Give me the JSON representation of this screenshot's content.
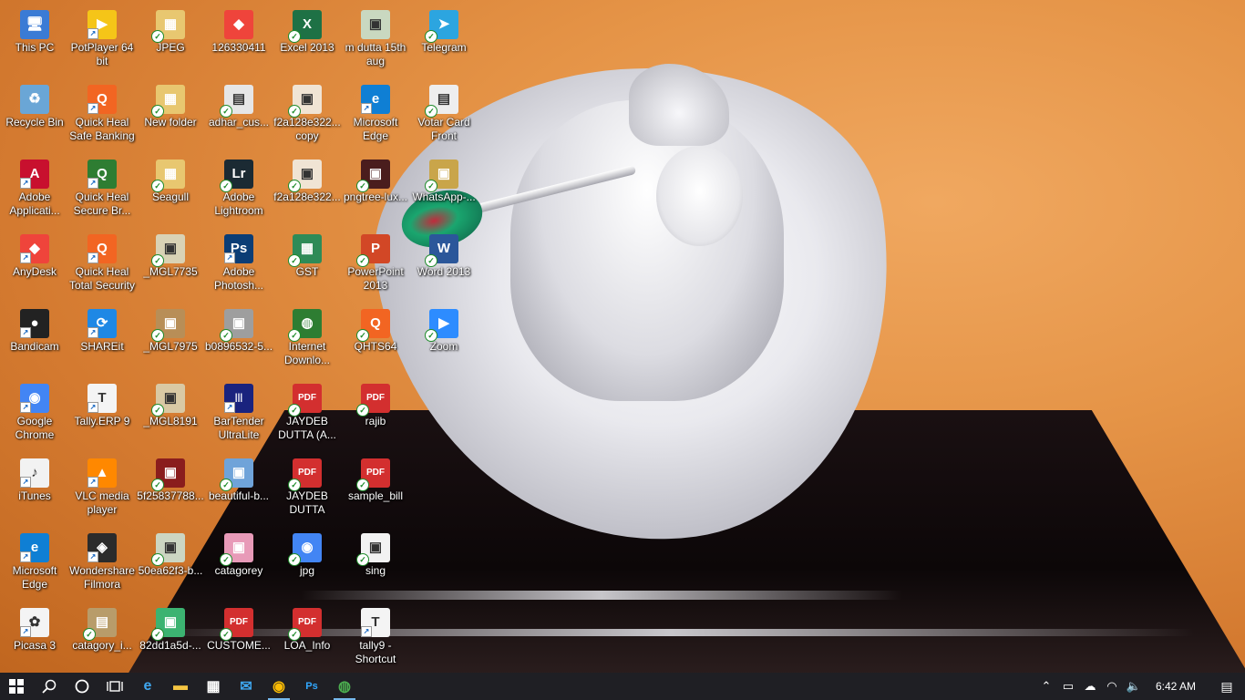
{
  "desktop": {
    "icons": [
      {
        "label": "This PC",
        "glyph": "🖥",
        "bg": "#3a7bd5",
        "badge": "none"
      },
      {
        "label": "Recycle Bin",
        "glyph": "♻",
        "bg": "#6aa6d6",
        "badge": "none"
      },
      {
        "label": "Adobe Applicati...",
        "glyph": "A",
        "bg": "#c8102e",
        "badge": "shortcut"
      },
      {
        "label": "AnyDesk",
        "glyph": "◆",
        "bg": "#ef443b",
        "badge": "shortcut"
      },
      {
        "label": "Bandicam",
        "glyph": "●",
        "bg": "#222222",
        "badge": "shortcut"
      },
      {
        "label": "Google Chrome",
        "glyph": "◉",
        "bg": "#4285f4",
        "badge": "shortcut"
      },
      {
        "label": "iTunes",
        "glyph": "♪",
        "bg": "#f2f2f2",
        "badge": "shortcut"
      },
      {
        "label": "Microsoft Edge",
        "glyph": "e",
        "bg": "#0f7fd4",
        "badge": "shortcut"
      },
      {
        "label": "Picasa 3",
        "glyph": "✿",
        "bg": "#f4f4f4",
        "badge": "shortcut"
      },
      {
        "label": "PotPlayer 64 bit",
        "glyph": "▶",
        "bg": "#f5c518",
        "badge": "shortcut"
      },
      {
        "label": "Quick Heal Safe Banking",
        "glyph": "Q",
        "bg": "#f26522",
        "badge": "shortcut"
      },
      {
        "label": "Quick Heal Secure Br...",
        "glyph": "Q",
        "bg": "#2e7d32",
        "badge": "shortcut"
      },
      {
        "label": "Quick Heal Total Security",
        "glyph": "Q",
        "bg": "#f26522",
        "badge": "shortcut"
      },
      {
        "label": "SHAREit",
        "glyph": "⟳",
        "bg": "#1e88e5",
        "badge": "shortcut"
      },
      {
        "label": "Tally.ERP 9",
        "glyph": "T",
        "bg": "#f4f4f4",
        "badge": "shortcut"
      },
      {
        "label": "VLC media player",
        "glyph": "▲",
        "bg": "#ff8800",
        "badge": "shortcut"
      },
      {
        "label": "Wondershare Filmora",
        "glyph": "◈",
        "bg": "#2b2b2b",
        "badge": "shortcut"
      },
      {
        "label": "catagory_i...",
        "glyph": "▤",
        "bg": "#b89c6a",
        "badge": "sync"
      },
      {
        "label": "JPEG",
        "glyph": "▦",
        "bg": "#e8c770",
        "badge": "sync"
      },
      {
        "label": "New folder",
        "glyph": "▦",
        "bg": "#e8c770",
        "badge": "sync"
      },
      {
        "label": "Seagull",
        "glyph": "▦",
        "bg": "#e8c770",
        "badge": "sync"
      },
      {
        "label": "_MGL7735",
        "glyph": "▣",
        "bg": "#d9d2b5",
        "badge": "sync"
      },
      {
        "label": "_MGL7975",
        "glyph": "▣",
        "bg": "#b88e57",
        "badge": "sync"
      },
      {
        "label": "_MGL8191",
        "glyph": "▣",
        "bg": "#d9c9a4",
        "badge": "sync"
      },
      {
        "label": "5f25837788...",
        "glyph": "▣",
        "bg": "#8a1d1d",
        "badge": "sync"
      },
      {
        "label": "50ea62f3-b...",
        "glyph": "▣",
        "bg": "#ccd6c2",
        "badge": "sync"
      },
      {
        "label": "82dd1a5d-...",
        "glyph": "▣",
        "bg": "#3cb371",
        "badge": "sync"
      },
      {
        "label": "126330411",
        "glyph": "◆",
        "bg": "#ef443b",
        "badge": "none"
      },
      {
        "label": "adhar_cus...",
        "glyph": "▤",
        "bg": "#e6e6e6",
        "badge": "sync"
      },
      {
        "label": "Adobe Lightroom",
        "glyph": "Lr",
        "bg": "#1b2a33",
        "badge": "sync"
      },
      {
        "label": "Adobe Photosh...",
        "glyph": "Ps",
        "bg": "#0b3d75",
        "badge": "shortcut"
      },
      {
        "label": "b0896532-5...",
        "glyph": "▣",
        "bg": "#9e9e9e",
        "badge": "sync"
      },
      {
        "label": "BarTender UltraLite",
        "glyph": "|||",
        "bg": "#1a237e",
        "badge": "shortcut"
      },
      {
        "label": "beautiful-b...",
        "glyph": "▣",
        "bg": "#6fa3d9",
        "badge": "sync"
      },
      {
        "label": "catagorey",
        "glyph": "▣",
        "bg": "#e89ab8",
        "badge": "sync"
      },
      {
        "label": "CUSTOME...",
        "glyph": "PDF",
        "bg": "#d32f2f",
        "badge": "sync"
      },
      {
        "label": "Excel 2013",
        "glyph": "X",
        "bg": "#1e7145",
        "badge": "sync"
      },
      {
        "label": "f2a128e322... copy",
        "glyph": "▣",
        "bg": "#f0e4d4",
        "badge": "sync"
      },
      {
        "label": "f2a128e322...",
        "glyph": "▣",
        "bg": "#f0e4d4",
        "badge": "sync"
      },
      {
        "label": "GST",
        "glyph": "▦",
        "bg": "#2e8b57",
        "badge": "sync"
      },
      {
        "label": "Internet Downlo...",
        "glyph": "◍",
        "bg": "#2e7d32",
        "badge": "sync"
      },
      {
        "label": "JAYDEB DUTTA (A...",
        "glyph": "PDF",
        "bg": "#d32f2f",
        "badge": "sync"
      },
      {
        "label": "JAYDEB DUTTA",
        "glyph": "PDF",
        "bg": "#d32f2f",
        "badge": "sync"
      },
      {
        "label": "jpg",
        "glyph": "◉",
        "bg": "#4285f4",
        "badge": "sync"
      },
      {
        "label": "LOA_Info",
        "glyph": "PDF",
        "bg": "#d32f2f",
        "badge": "sync"
      },
      {
        "label": "m dutta 15th aug",
        "glyph": "▣",
        "bg": "#c9d8c0",
        "badge": "none"
      },
      {
        "label": "Microsoft Edge",
        "glyph": "e",
        "bg": "#0f7fd4",
        "badge": "shortcut"
      },
      {
        "label": "pngtree-lux...",
        "glyph": "▣",
        "bg": "#4a1d1d",
        "badge": "sync"
      },
      {
        "label": "PowerPoint 2013",
        "glyph": "P",
        "bg": "#d24726",
        "badge": "sync"
      },
      {
        "label": "QHTS64",
        "glyph": "Q",
        "bg": "#f26522",
        "badge": "sync"
      },
      {
        "label": "rajib",
        "glyph": "PDF",
        "bg": "#d32f2f",
        "badge": "sync"
      },
      {
        "label": "sample_bill",
        "glyph": "PDF",
        "bg": "#d32f2f",
        "badge": "sync"
      },
      {
        "label": "sing",
        "glyph": "▣",
        "bg": "#f2f2f2",
        "badge": "sync"
      },
      {
        "label": "tally9 - Shortcut",
        "glyph": "T",
        "bg": "#f4f4f4",
        "badge": "shortcut"
      },
      {
        "label": "Telegram",
        "glyph": "➤",
        "bg": "#2ca5e0",
        "badge": "sync"
      },
      {
        "label": "Votar Card Front",
        "glyph": "▤",
        "bg": "#eeeeee",
        "badge": "sync"
      },
      {
        "label": "WhatsApp-...",
        "glyph": "▣",
        "bg": "#c9a54a",
        "badge": "sync"
      },
      {
        "label": "Word 2013",
        "glyph": "W",
        "bg": "#2b579a",
        "badge": "sync"
      },
      {
        "label": "Zoom",
        "glyph": "▶",
        "bg": "#2d8cff",
        "badge": "sync"
      }
    ]
  },
  "taskbar": {
    "start": {
      "icon": "windows-logo-icon"
    },
    "search": {
      "icon": "search-icon"
    },
    "cortana": {
      "icon": "cortana-circle-icon"
    },
    "task_view": {
      "icon": "task-view-icon"
    },
    "apps": [
      {
        "name": "Microsoft Edge",
        "icon": "edge-icon",
        "glyph": "e",
        "color": "#3fa7f0",
        "running": false
      },
      {
        "name": "File Explorer",
        "icon": "folder-icon",
        "glyph": "▬",
        "color": "#f5c542",
        "running": false
      },
      {
        "name": "Microsoft Store",
        "icon": "store-icon",
        "glyph": "▦",
        "color": "#ffffff",
        "running": false
      },
      {
        "name": "Mail",
        "icon": "mail-icon",
        "glyph": "✉",
        "color": "#3fa7f0",
        "running": false
      },
      {
        "name": "Google Chrome",
        "icon": "chrome-icon",
        "glyph": "◉",
        "color": "#fbbc05",
        "running": true
      },
      {
        "name": "Adobe Photoshop",
        "icon": "photoshop-icon",
        "glyph": "Ps",
        "color": "#31a8ff",
        "running": false
      },
      {
        "name": "Internet Download Manager",
        "icon": "idm-icon",
        "glyph": "◍",
        "color": "#4caf50",
        "running": true
      }
    ],
    "tray": [
      {
        "name": "show-hidden",
        "icon": "chevron-up-icon",
        "glyph": "⌃"
      },
      {
        "name": "device",
        "icon": "device-icon",
        "glyph": "▭"
      },
      {
        "name": "onedrive",
        "icon": "cloud-icon",
        "glyph": "☁"
      },
      {
        "name": "wifi",
        "icon": "wifi-icon",
        "glyph": "◠"
      },
      {
        "name": "volume",
        "icon": "speaker-icon",
        "glyph": "🔈"
      }
    ],
    "clock": "6:42 AM",
    "notifications": {
      "icon": "notification-icon",
      "glyph": "▤"
    }
  }
}
